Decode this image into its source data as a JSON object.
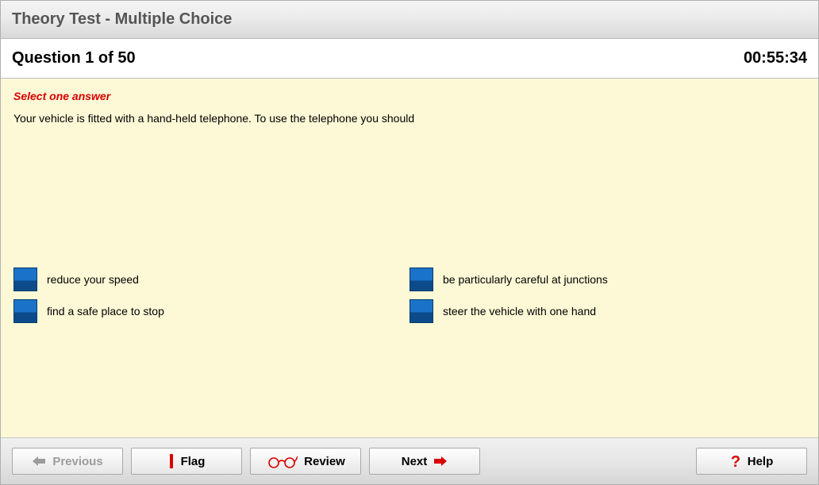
{
  "title": "Theory Test - Multiple Choice",
  "status": {
    "question_label": "Question 1 of 50",
    "time": "00:55:34"
  },
  "instruction": "Select one answer",
  "question": "Your vehicle is fitted with a hand-held telephone. To use the telephone you should",
  "answers": [
    {
      "text": "reduce your speed"
    },
    {
      "text": "be particularly careful at junctions"
    },
    {
      "text": "find a safe place to stop"
    },
    {
      "text": "steer the vehicle with one hand"
    }
  ],
  "buttons": {
    "previous": "Previous",
    "flag": "Flag",
    "review": "Review",
    "next": "Next",
    "help": "Help"
  }
}
